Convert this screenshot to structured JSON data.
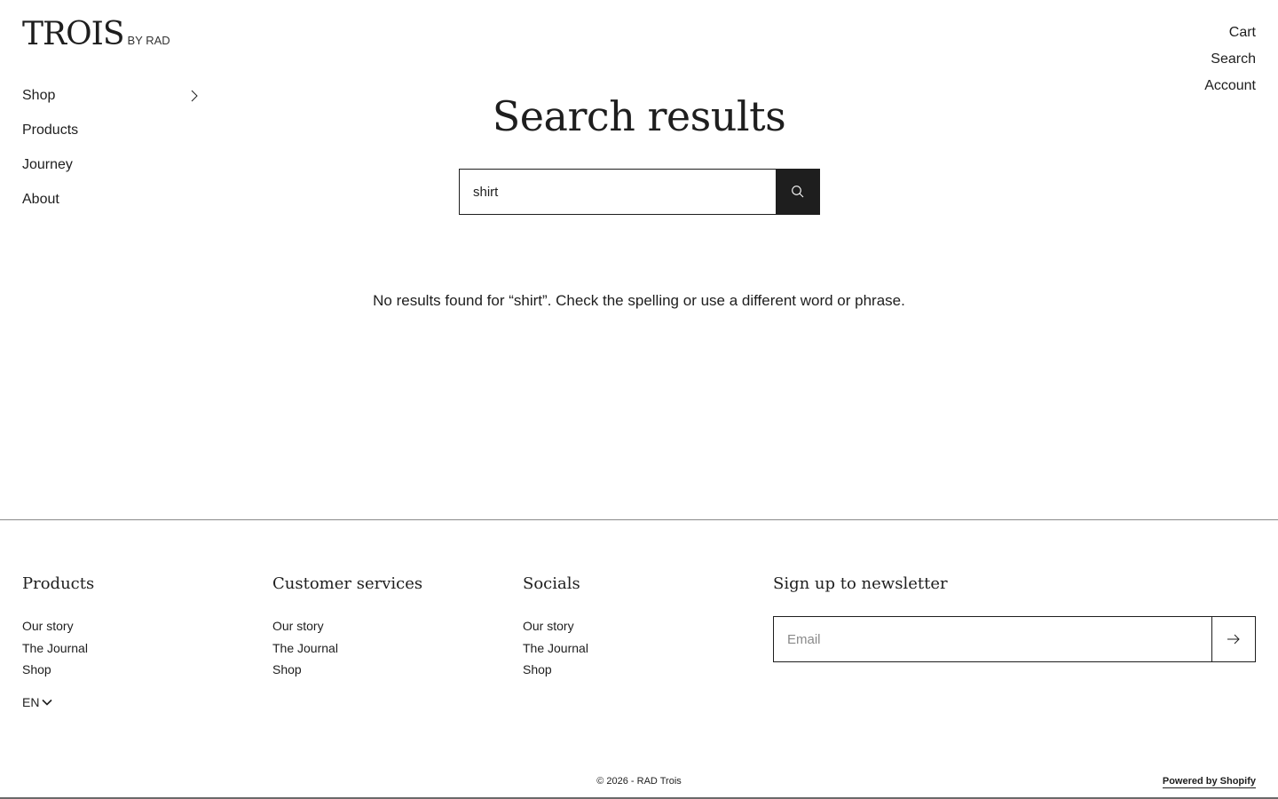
{
  "header": {
    "logo_main": "TROIS",
    "logo_sub": "BY RAD",
    "nav": [
      {
        "label": "Shop"
      },
      {
        "label": "Products"
      },
      {
        "label": "Journey"
      },
      {
        "label": "About"
      }
    ],
    "top_links": [
      "Cart",
      "Search",
      "Account"
    ]
  },
  "main": {
    "title": "Search results",
    "search": {
      "value": "shirt",
      "button_icon": "search-icon"
    },
    "message": "No results found for “shirt”. Check the spelling or use a different word or phrase."
  },
  "footer": {
    "columns": [
      {
        "heading": "Products",
        "links": [
          "Our story",
          "The Journal",
          "Shop"
        ]
      },
      {
        "heading": "Customer services",
        "links": [
          "Our story",
          "The Journal",
          "Shop"
        ]
      },
      {
        "heading": "Socials",
        "links": [
          "Our story",
          "The Journal",
          "Shop"
        ]
      }
    ],
    "newsletter": {
      "heading": "Sign up to newsletter",
      "placeholder": "Email",
      "button_icon": "arrow-right-icon"
    },
    "language": "EN",
    "copyright": "© 2026 - RAD Trois",
    "powered_by": "Powered by Shopify"
  },
  "colors": {
    "text": "#1e1e1e",
    "background": "#ffffff",
    "button": "#1e1e1e"
  }
}
